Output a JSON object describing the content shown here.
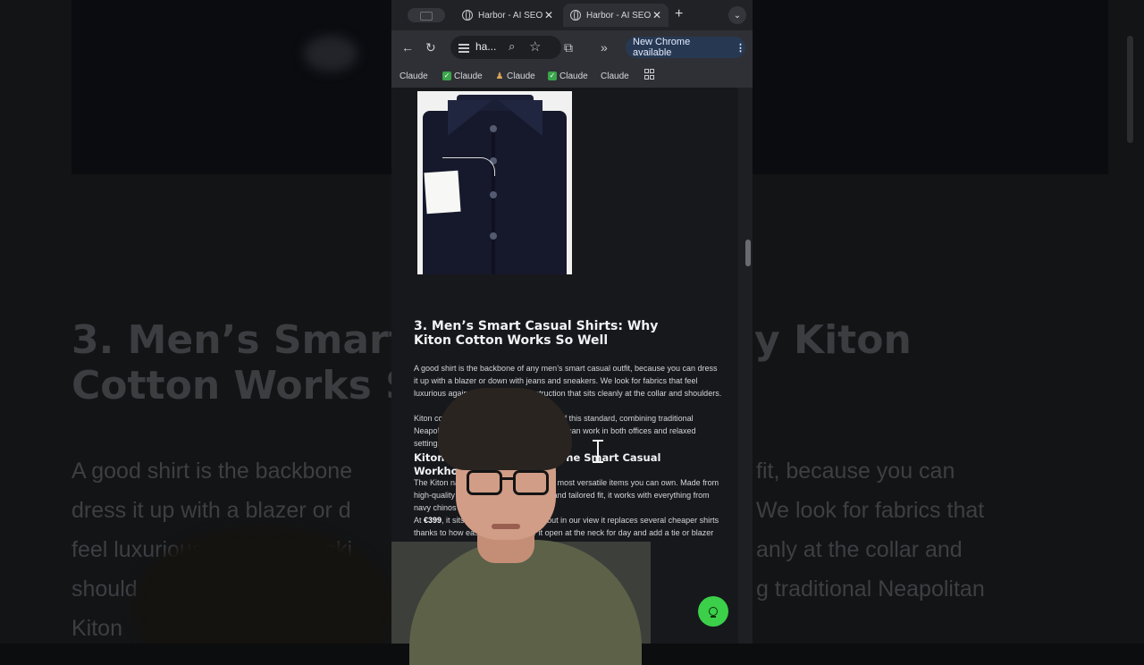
{
  "background": {
    "heading_left": "3. Men’s Smart C",
    "heading_left_2": "Cotton Works S",
    "heading_right": "y Kiton",
    "para_left": [
      "A good shirt is the backbone",
      "dress it up with a blazer or d",
      "feel luxurious against the ski",
      "should",
      "Kiton"
    ],
    "para_right": [
      "fit, because you can",
      "We look for fabrics that",
      "anly at the collar and",
      "",
      "g traditional Neapolitan"
    ]
  },
  "browser": {
    "tabs": [
      {
        "title": "Harbor - AI SEO",
        "close": "✕",
        "active": false
      },
      {
        "title": "Harbor - AI SEO",
        "close": "✕",
        "active": true
      }
    ],
    "new_tab": "+",
    "tab_menu": "⌄",
    "toolbar": {
      "back": "←",
      "reload": "↻",
      "url": "ha...",
      "zoom_icon": "⌕",
      "star": "☆",
      "extensions": "⧉",
      "more": "»",
      "update_label": "New Chrome available",
      "update_menu": "⋮"
    },
    "bookmarks": [
      {
        "label": "Claude",
        "icon": "none"
      },
      {
        "label": "Claude",
        "icon": "check"
      },
      {
        "label": "Claude",
        "icon": "figure"
      },
      {
        "label": "Claude",
        "icon": "check"
      },
      {
        "label": "Claude",
        "icon": "none"
      }
    ]
  },
  "article": {
    "heading": "3. Men’s Smart Casual Shirts: Why Kiton Cotton Works So Well",
    "paragraph_1": "A good shirt is the backbone of any men’s smart casual outfit, because you can dress it up with a blazer or down with jeans and sneakers. We look for fabrics that feel luxurious against the skin and construction that sits cleanly at the collar and shoulders.",
    "paragraph_2": "Kiton cotton shirts are a perfect example of this standard, combining traditional Neapolitan tailoring with a refined look that can work in both offices and relaxed settings.",
    "subheading": "Kiton Navy Cotton Shirt: The Smart Casual Workhorse",
    "paragraph_3": "The Kiton navy cotton shirt is one of the most versatile items you can own. Made from high-quality cotton with a spread collar and tailored fit, it works with everything from navy chinos to grey trousers.",
    "paragraph_4_prefix": "At ",
    "paragraph_4_price": "€399",
    "paragraph_4_rest": ", it sits in the premium range, but in our view it replaces several cheaper shirts thanks to how easily you can wear it open at the neck for day and add a tie or blazer when you need something else."
  },
  "colors": {
    "accent_green": "#3bcf4a",
    "update_pill": "#273952"
  },
  "icons": {
    "fab": "lightbulb-icon"
  }
}
